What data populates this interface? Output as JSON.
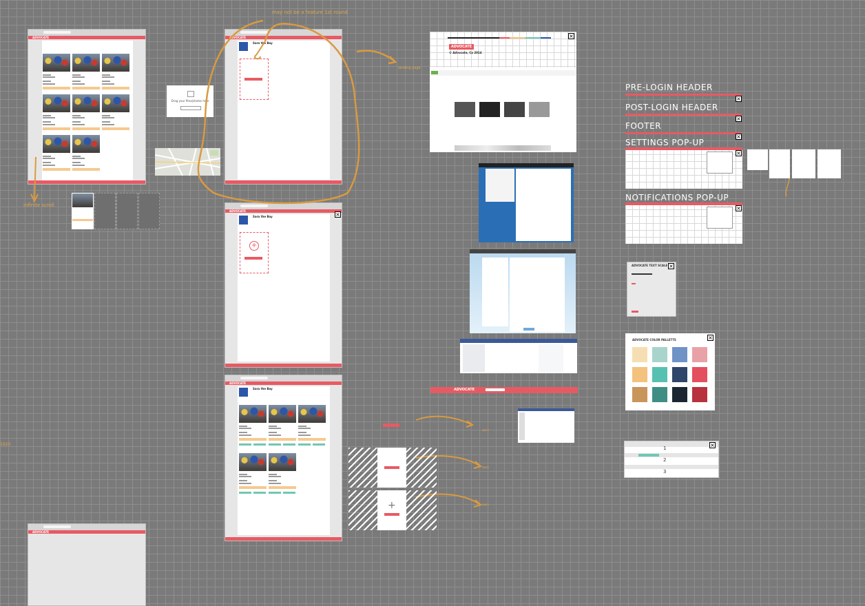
{
  "annotations": {
    "top_note": "may not be a feature 1st round",
    "infinite_scroll": "infinite scroll",
    "landing_page": "landing page",
    "left_edge": "1920",
    "small_1": "open ",
    "small_2": "open ",
    "small_3": "open "
  },
  "headings": {
    "pre_login": "PRE-LOGIN HEADER",
    "post_login": "POST-LOGIN HEADER",
    "footer": "FOOTER",
    "settings": "SETTINGS POP-UP",
    "notifications": "NOTIFICATIONS POP-UP"
  },
  "brand": "ADVOCATE",
  "profile_name": "Sara the Bay",
  "drop_zone_text": "Drag your files/photos here",
  "text_scale_title": "ADVOCATE TEXT SCALE",
  "color_palette_title": "ADVOCATE COLOR PALLETTE",
  "advocate_dates": "© Advocate, Ca 2014",
  "list_numbers": [
    "1",
    "2",
    "3"
  ],
  "palette_colors": [
    "#f6deb3",
    "#a8d4cc",
    "#6f93c6",
    "#e9a1a8",
    "#f3c27d",
    "#56c1b1",
    "#2f4569",
    "#e4505e",
    "#c8955a",
    "#3f8e84",
    "#1c2633",
    "#b8323d"
  ],
  "accent_color": "#e85a63",
  "annotation_color": "#e0a64a",
  "icons": [
    "close-icon",
    "plus-icon",
    "image-icon"
  ]
}
